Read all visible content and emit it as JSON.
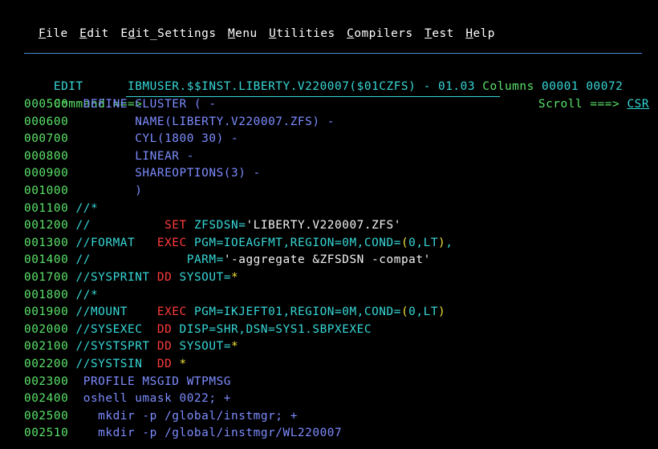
{
  "menu": [
    {
      "key": "F",
      "rest": "ile"
    },
    {
      "key": "E",
      "rest": "dit"
    },
    {
      "key": "",
      "pre": "E",
      "key2": "d",
      "rest": "it_Settings"
    },
    {
      "key": "M",
      "rest": "enu"
    },
    {
      "key": "U",
      "rest": "tilities"
    },
    {
      "key": "C",
      "rest": "ompilers"
    },
    {
      "key": "T",
      "rest": "est"
    },
    {
      "key": "H",
      "rest": "elp"
    }
  ],
  "header": {
    "mode": "EDIT",
    "dataset": "IBMUSER.$$INST.LIBERTY.V220007($01CZFS) - 01.03",
    "columns_label": "Columns",
    "col_start": "00001",
    "col_end": "00072"
  },
  "command": {
    "label": "Command ===>",
    "value": "",
    "scroll_label": "Scroll ===>",
    "scroll_value": "CSR"
  },
  "lines": [
    {
      "seq": "000500",
      "segs": [
        {
          "c": "blue",
          "t": "  DEFINE CLUSTER ( -"
        }
      ]
    },
    {
      "seq": "000600",
      "segs": [
        {
          "c": "blue",
          "t": "         NAME(LIBERTY.V220007.ZFS) -"
        }
      ]
    },
    {
      "seq": "000700",
      "segs": [
        {
          "c": "blue",
          "t": "         CYL(1800 30) -"
        }
      ]
    },
    {
      "seq": "000800",
      "segs": [
        {
          "c": "blue",
          "t": "         LINEAR -"
        }
      ]
    },
    {
      "seq": "000900",
      "segs": [
        {
          "c": "blue",
          "t": "         SHAREOPTIONS(3) -"
        }
      ]
    },
    {
      "seq": "001000",
      "segs": [
        {
          "c": "blue",
          "t": "         )"
        }
      ]
    },
    {
      "seq": "001100",
      "segs": [
        {
          "c": "cyan",
          "t": " //*"
        }
      ]
    },
    {
      "seq": "001200",
      "segs": [
        {
          "c": "cyan",
          "t": " //"
        },
        {
          "c": "red",
          "t": "          SET "
        },
        {
          "c": "cyan",
          "t": "ZFSDSN="
        },
        {
          "c": "white",
          "t": "'LIBERTY.V220007.ZFS'"
        }
      ]
    },
    {
      "seq": "001300",
      "segs": [
        {
          "c": "cyan",
          "t": " //FORMAT   "
        },
        {
          "c": "red",
          "t": "EXEC "
        },
        {
          "c": "cyan",
          "t": "PGM=IOEAGFMT,REGION=0M,COND="
        },
        {
          "c": "yellow",
          "t": "("
        },
        {
          "c": "cyan",
          "t": "0,LT"
        },
        {
          "c": "yellow",
          "t": ")"
        },
        {
          "c": "cyan",
          "t": ","
        }
      ]
    },
    {
      "seq": "001400",
      "segs": [
        {
          "c": "cyan",
          "t": " //"
        },
        {
          "c": "white",
          "t": "             "
        },
        {
          "c": "cyan",
          "t": "PARM="
        },
        {
          "c": "white",
          "t": "'-aggregate &ZFSDSN -compat'"
        }
      ]
    },
    {
      "seq": "001700",
      "segs": [
        {
          "c": "cyan",
          "t": " //SYSPRINT "
        },
        {
          "c": "red",
          "t": "DD "
        },
        {
          "c": "cyan",
          "t": "SYSOUT="
        },
        {
          "c": "yellow",
          "t": "*"
        }
      ]
    },
    {
      "seq": "001800",
      "segs": [
        {
          "c": "cyan",
          "t": " //*"
        }
      ]
    },
    {
      "seq": "001900",
      "segs": [
        {
          "c": "cyan",
          "t": " //MOUNT    "
        },
        {
          "c": "red",
          "t": "EXEC "
        },
        {
          "c": "cyan",
          "t": "PGM=IKJEFT01,REGION=0M,COND="
        },
        {
          "c": "yellow",
          "t": "("
        },
        {
          "c": "cyan",
          "t": "0,LT"
        },
        {
          "c": "yellow",
          "t": ")"
        }
      ]
    },
    {
      "seq": "002000",
      "segs": [
        {
          "c": "cyan",
          "t": " //SYSEXEC  "
        },
        {
          "c": "red",
          "t": "DD "
        },
        {
          "c": "cyan",
          "t": "DISP=SHR,DSN=SYS1.SBPXEXEC"
        }
      ]
    },
    {
      "seq": "002100",
      "segs": [
        {
          "c": "cyan",
          "t": " //SYSTSPRT "
        },
        {
          "c": "red",
          "t": "DD "
        },
        {
          "c": "cyan",
          "t": "SYSOUT="
        },
        {
          "c": "yellow",
          "t": "*"
        }
      ]
    },
    {
      "seq": "002200",
      "segs": [
        {
          "c": "cyan",
          "t": " //SYSTSIN  "
        },
        {
          "c": "red",
          "t": "DD "
        },
        {
          "c": "yellow",
          "t": "*"
        }
      ]
    },
    {
      "seq": "002300",
      "segs": [
        {
          "c": "blue",
          "t": "  PROFILE MSGID WTPMSG"
        }
      ]
    },
    {
      "seq": "002400",
      "segs": [
        {
          "c": "blue",
          "t": "  oshell umask 0022; +"
        }
      ]
    },
    {
      "seq": "002500",
      "segs": [
        {
          "c": "blue",
          "t": "    mkdir -p /global/instmgr; +"
        }
      ]
    },
    {
      "seq": "002510",
      "segs": [
        {
          "c": "blue",
          "t": "    mkdir -p /global/instmgr/WL220007"
        }
      ]
    }
  ],
  "colors": {
    "background": "#000000",
    "sequence": "#5be36a",
    "jcl": "#37d7d7",
    "data": "#7d8cff",
    "keyword": "#ff3b3b",
    "literal": "#f2f2f2",
    "special": "#f2e03a",
    "rule": "#4a8cd9"
  }
}
